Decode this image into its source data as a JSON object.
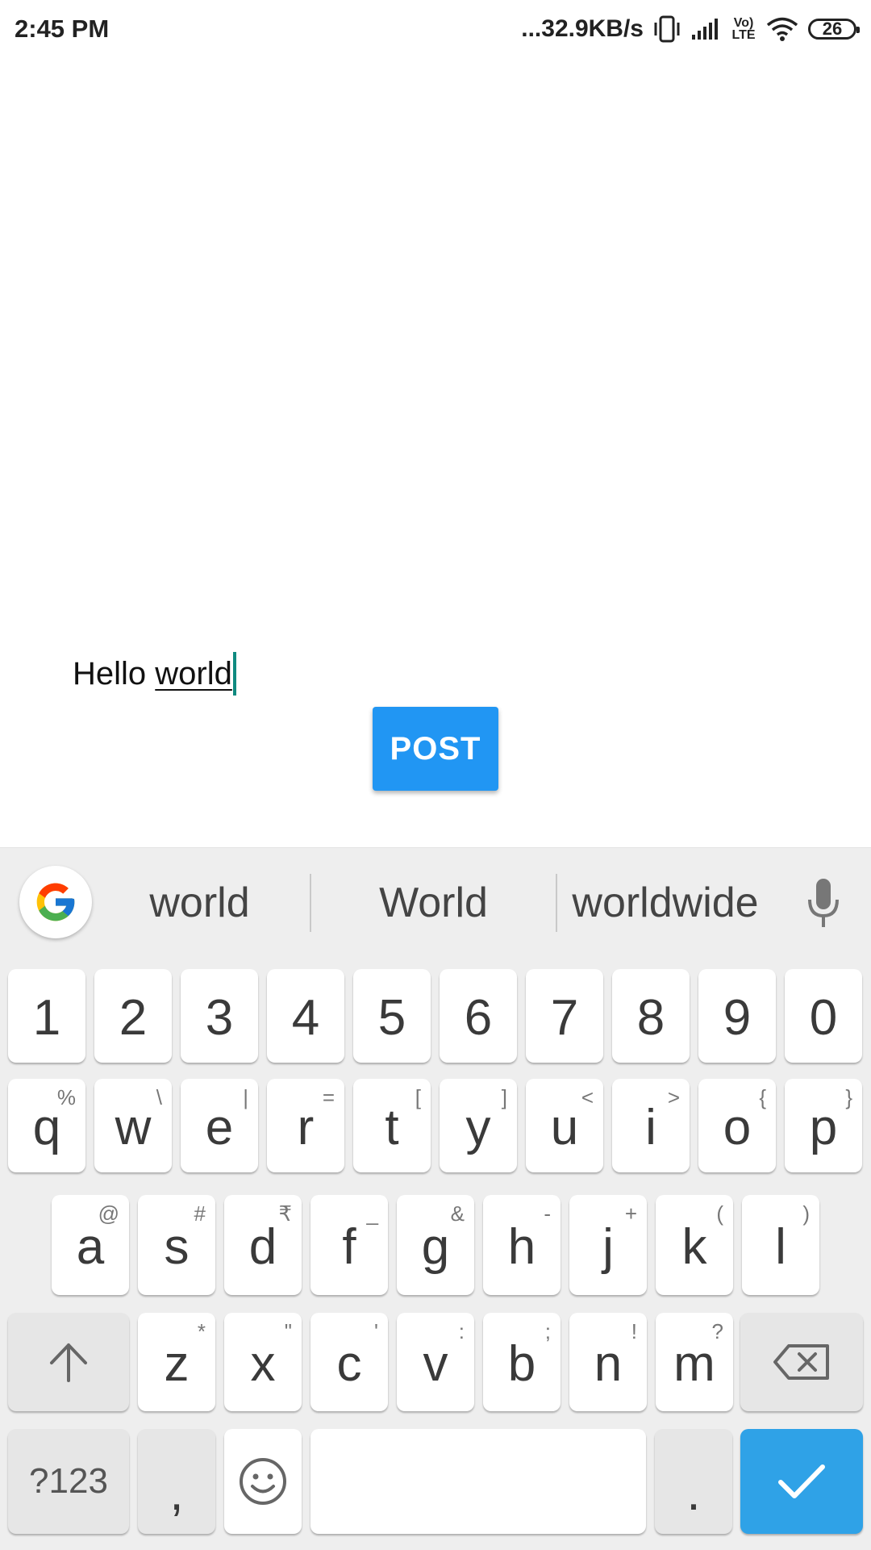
{
  "status_bar": {
    "time": "2:45 PM",
    "network_speed": "...32.9KB/s",
    "volte": "Vo) LTE",
    "battery": "26"
  },
  "editor": {
    "text_before": "Hello ",
    "composing_word": "world",
    "cursor_color": "#0f8a80"
  },
  "post_button": {
    "label": "POST",
    "color": "#2196f3"
  },
  "keyboard": {
    "suggestions": [
      "world",
      "World",
      "worldwide"
    ],
    "number_row": [
      "1",
      "2",
      "3",
      "4",
      "5",
      "6",
      "7",
      "8",
      "9",
      "0"
    ],
    "row1": [
      {
        "key": "q",
        "hint": "%"
      },
      {
        "key": "w",
        "hint": "\\"
      },
      {
        "key": "e",
        "hint": "|"
      },
      {
        "key": "r",
        "hint": "="
      },
      {
        "key": "t",
        "hint": "["
      },
      {
        "key": "y",
        "hint": "]"
      },
      {
        "key": "u",
        "hint": "<"
      },
      {
        "key": "i",
        "hint": ">"
      },
      {
        "key": "o",
        "hint": "{"
      },
      {
        "key": "p",
        "hint": "}"
      }
    ],
    "row2": [
      {
        "key": "a",
        "hint": "@"
      },
      {
        "key": "s",
        "hint": "#"
      },
      {
        "key": "d",
        "hint": "₹"
      },
      {
        "key": "f",
        "hint": "_"
      },
      {
        "key": "g",
        "hint": "&"
      },
      {
        "key": "h",
        "hint": "-"
      },
      {
        "key": "j",
        "hint": "+"
      },
      {
        "key": "k",
        "hint": "("
      },
      {
        "key": "l",
        "hint": ")"
      }
    ],
    "row3": [
      {
        "key": "z",
        "hint": "*"
      },
      {
        "key": "x",
        "hint": "\""
      },
      {
        "key": "c",
        "hint": "'"
      },
      {
        "key": "v",
        "hint": ":"
      },
      {
        "key": "b",
        "hint": ";"
      },
      {
        "key": "n",
        "hint": "!"
      },
      {
        "key": "m",
        "hint": "?"
      }
    ],
    "symbols_key": "?123",
    "comma_key": ",",
    "period_key": ".",
    "enter_color": "#2fa2e7"
  }
}
